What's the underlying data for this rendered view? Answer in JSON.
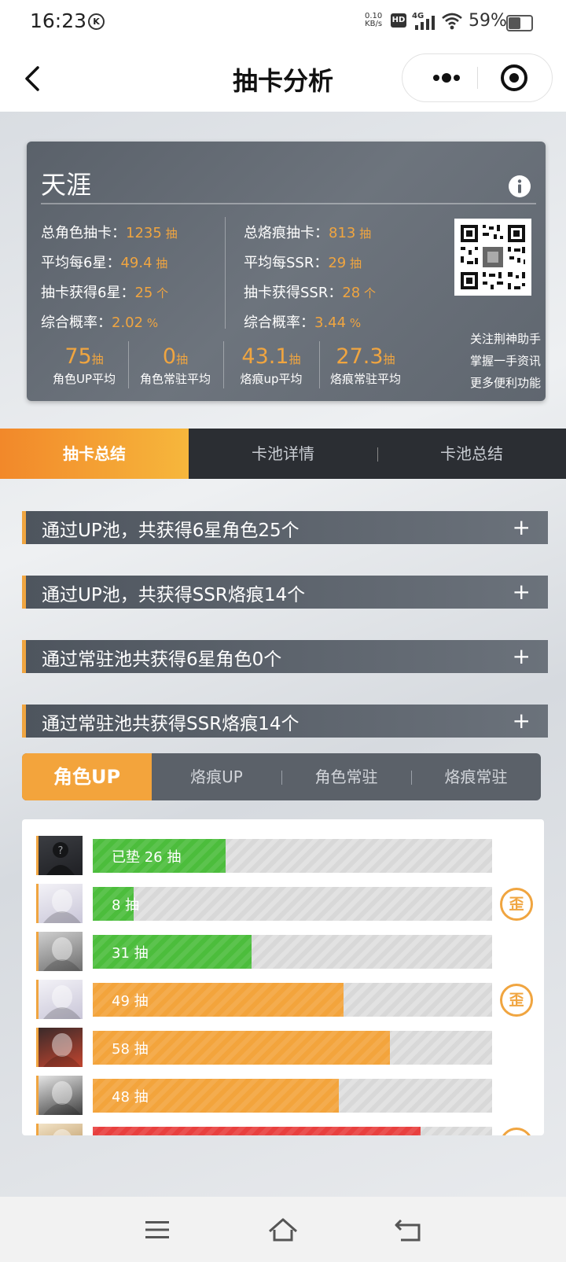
{
  "status_bar": {
    "time": "16:23",
    "k_badge": "K",
    "net_speed_value": "0.10",
    "net_speed_unit": "KB/s",
    "hd": "HD",
    "network": "4G",
    "battery_text": "59%",
    "battery_level": 0.59
  },
  "header": {
    "title": "抽卡分析"
  },
  "profile": {
    "name": "天涯",
    "stats_left": [
      {
        "label": "总角色抽卡：",
        "value": "1235",
        "unit": " 抽"
      },
      {
        "label": "平均每6星：",
        "value": "49.4",
        "unit": " 抽"
      },
      {
        "label": "抽卡获得6星：",
        "value": "25",
        "unit": " 个"
      },
      {
        "label": "综合概率：",
        "value": "2.02",
        "unit": " %"
      }
    ],
    "stats_right": [
      {
        "label": "总烙痕抽卡：",
        "value": "813",
        "unit": " 抽"
      },
      {
        "label": "平均每SSR：",
        "value": "29",
        "unit": " 抽"
      },
      {
        "label": "抽卡获得SSR：",
        "value": "28",
        "unit": " 个"
      },
      {
        "label": "综合概率：",
        "value": "3.44",
        "unit": " %"
      }
    ],
    "promo": [
      "关注荆神助手",
      "掌握一手资讯",
      "更多便利功能"
    ],
    "averages": [
      {
        "value": "75",
        "unit": "抽",
        "label": "角色UP平均"
      },
      {
        "value": "0",
        "unit": "抽",
        "label": "角色常驻平均"
      },
      {
        "value": "43.1",
        "unit": "抽",
        "label": "烙痕up平均"
      },
      {
        "value": "27.3",
        "unit": "抽",
        "label": "烙痕常驻平均"
      }
    ]
  },
  "main_tabs": [
    "抽卡总结",
    "卡池详情",
    "卡池总结"
  ],
  "accordions": [
    "通过UP池，共获得6星角色25个",
    "通过UP池，共获得SSR烙痕14个",
    "通过常驻池共获得6星角色0个",
    "通过常驻池共获得SSR烙痕14个"
  ],
  "sub_tabs": [
    "角色UP",
    "烙痕UP",
    "角色常驻",
    "烙痕常驻"
  ],
  "pull_list": [
    {
      "label": "已垫 26 抽",
      "pulls": 26,
      "color": "#4cbd3c",
      "off_banner": false,
      "avatar": "unknown"
    },
    {
      "label": "8 抽",
      "pulls": 8,
      "color": "#4cbd3c",
      "off_banner": true,
      "avatar": "white-hair"
    },
    {
      "label": "31 抽",
      "pulls": 31,
      "color": "#4cbd3c",
      "off_banner": false,
      "avatar": "grey-hair"
    },
    {
      "label": "49 抽",
      "pulls": 49,
      "color": "#f3a43c",
      "off_banner": true,
      "avatar": "white-hair"
    },
    {
      "label": "58 抽",
      "pulls": 58,
      "color": "#f3a43c",
      "off_banner": false,
      "avatar": "red-dark"
    },
    {
      "label": "48 抽",
      "pulls": 48,
      "color": "#f3a43c",
      "off_banner": false,
      "avatar": "dark-hair"
    },
    {
      "label": "",
      "pulls": 64,
      "color": "#e8403f",
      "off_banner": true,
      "avatar": "gold"
    }
  ],
  "pull_scale_max": 78,
  "off_banner_glyph": "歪",
  "unknown_glyph": "?"
}
